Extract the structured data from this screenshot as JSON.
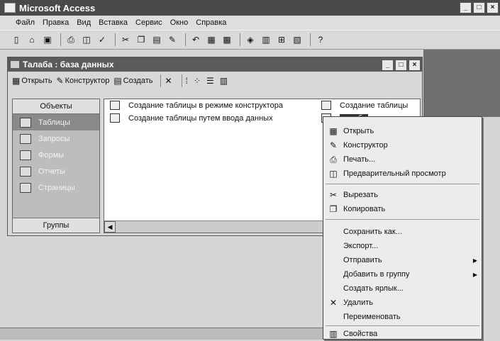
{
  "app": {
    "title": "Microsoft Access"
  },
  "window_controls": {
    "minimize": "_",
    "maximize": "□",
    "close": "×"
  },
  "menu": [
    "Файл",
    "Правка",
    "Вид",
    "Вставка",
    "Сервис",
    "Окно",
    "Справка"
  ],
  "db_window": {
    "title": "Талаба : база данных",
    "toolbar": {
      "open": "Открыть",
      "design": "Конструктор",
      "create": "Создать"
    },
    "objects_header": "Объекты",
    "objects": [
      "Таблицы",
      "Запросы",
      "Формы",
      "Отчеты",
      "Страницы"
    ],
    "groups_footer": "Группы",
    "list": [
      "Создание таблицы в режиме конструктора",
      "Создание таблицы путем ввода данных",
      "Создание таблицы",
      "талаба"
    ]
  },
  "context_menu": {
    "items": [
      {
        "label": "Открыть",
        "icon": "table-icon"
      },
      {
        "label": "Конструктор",
        "icon": "design-icon"
      },
      {
        "label": "Печать...",
        "icon": "print-icon"
      },
      {
        "label": "Предварительный просмотр",
        "icon": "preview-icon"
      },
      {
        "label": "Вырезать",
        "icon": "scissors-icon"
      },
      {
        "label": "Копировать",
        "icon": "copy-icon"
      },
      {
        "label": "Сохранить как...",
        "icon": ""
      },
      {
        "label": "Экспорт...",
        "icon": ""
      },
      {
        "label": "Отправить",
        "icon": ""
      },
      {
        "label": "Добавить в группу",
        "icon": ""
      },
      {
        "label": "Создать ярлык...",
        "icon": ""
      },
      {
        "label": "Удалить",
        "icon": "delete-icon"
      },
      {
        "label": "Переименовать",
        "icon": ""
      },
      {
        "label": "Свойства",
        "icon": "properties-icon"
      }
    ]
  }
}
